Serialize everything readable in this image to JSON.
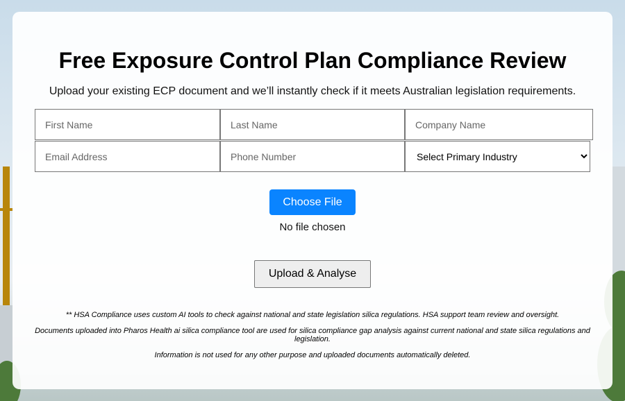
{
  "form": {
    "title": "Free Exposure Control Plan Compliance Review",
    "subtitle": "Upload your existing ECP document and we’ll instantly check if it meets Australian legislation requirements.",
    "fields": {
      "first_name": "First Name",
      "last_name": "Last Name",
      "company_name": "Company Name",
      "email": "Email Address",
      "phone": "Phone Number"
    },
    "industry_select": {
      "selected": "Select Primary Industry"
    },
    "choose_file_label": "Choose File",
    "file_status": "No file chosen",
    "upload_label": "Upload & Analyse",
    "notes": [
      "** HSA Compliance uses custom AI tools to check against national and state legislation silica regulations. HSA support team review and oversight.",
      "Documents uploaded into Pharos Health ai silica compliance tool are used for silica compliance gap analysis against current national and state silica regulations and legislation.",
      "Information is not used for any other purpose and uploaded documents automatically deleted."
    ]
  }
}
